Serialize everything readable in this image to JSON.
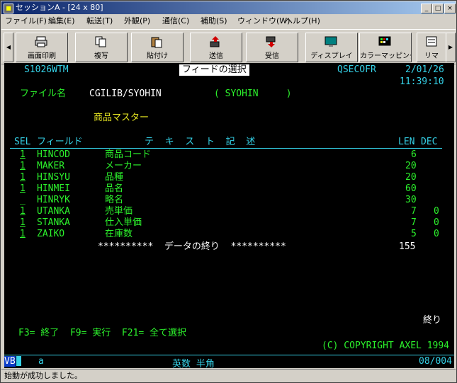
{
  "window": {
    "title": "セッションA - [24 x 80]",
    "min": "_",
    "max": "□",
    "close": "×",
    "app_icon": "terminal-icon"
  },
  "menu": [
    "ファイル(F)",
    "編集(E)",
    "転送(T)",
    "外観(P)",
    "通信(C)",
    "補助(S)",
    "ウィンドウ(W)",
    "ヘルプ(H)"
  ],
  "toolbar": {
    "left_arrow": "◀",
    "right_arrow": "▶",
    "tools": [
      {
        "label": "画面印刷",
        "icon": "print-icon"
      },
      {
        "label": "複写",
        "icon": "copy-icon"
      },
      {
        "label": "貼付け",
        "icon": "paste-icon"
      },
      {
        "label": "送信",
        "icon": "send-icon"
      },
      {
        "label": "受信",
        "icon": "receive-icon"
      },
      {
        "label": "ディスプレイ",
        "icon": "display-icon"
      },
      {
        "label": "カラーマッピング",
        "icon": "color-mapping-icon"
      },
      {
        "label": "リマ",
        "icon": "remap-icon"
      }
    ]
  },
  "terminal": {
    "program_id": "S1026WTM",
    "screen_title": "フィードの選択",
    "user": "QSECOFR",
    "date": "2/01/26",
    "time": "11:39:10",
    "file_label": "ファイル名",
    "file_value": "CGILIB/SYOHIN",
    "file_member": "( SYOHIN     )",
    "file_desc": "商品マスター",
    "headers": {
      "sel": "SEL",
      "field": "フィールド",
      "text": "テ  キ  ス  ト  記  述",
      "len": "LEN",
      "dec": "DEC"
    },
    "rows": [
      {
        "sel": "1",
        "field": "HINCOD",
        "text": "商品コード",
        "len": "6",
        "dec": ""
      },
      {
        "sel": "1",
        "field": "MAKER",
        "text": "メーカー",
        "len": "20",
        "dec": ""
      },
      {
        "sel": "1",
        "field": "HINSYU",
        "text": "品種",
        "len": "20",
        "dec": ""
      },
      {
        "sel": "1",
        "field": "HINMEI",
        "text": "品名",
        "len": "60",
        "dec": ""
      },
      {
        "sel": "_",
        "field": "HINRYK",
        "text": "略名",
        "len": "30",
        "dec": ""
      },
      {
        "sel": "1",
        "field": "UTANKA",
        "text": "売単価",
        "len": "7",
        "dec": "0"
      },
      {
        "sel": "1",
        "field": "STANKA",
        "text": "仕入単価",
        "len": "7",
        "dec": "0"
      },
      {
        "sel": "1",
        "field": "ZAIKO",
        "text": "在庫数",
        "len": "5",
        "dec": "0"
      }
    ],
    "end_of_data": "**********  データの終り  **********",
    "total_len": "155",
    "end_marker": "終り",
    "function_keys": "F3= 終了  F9= 実行  F21= 全て選択",
    "copyright": "(C) COPYRIGHT AXEL 1994"
  },
  "oia": {
    "vb": "VB",
    "cursor": " ",
    "mode": "a",
    "input_mode": "英数 半角",
    "position": "08/004"
  },
  "status": "始動が成功しました。"
}
